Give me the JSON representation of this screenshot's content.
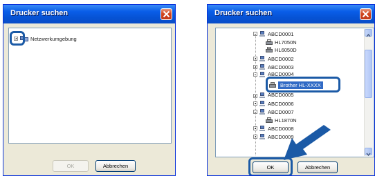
{
  "left_dialog": {
    "title": "Drucker suchen",
    "tree": [
      {
        "label": "Netzwerkumgebung",
        "icon": "network-icon"
      }
    ],
    "buttons": {
      "ok": "OK",
      "cancel": "Abbrechen"
    }
  },
  "right_dialog": {
    "title": "Drucker suchen",
    "tree": [
      {
        "label": "ABCD0001",
        "type": "computer",
        "expanded": true
      },
      {
        "label": "HL7050N",
        "type": "printer"
      },
      {
        "label": "HL6050D",
        "type": "printer"
      },
      {
        "label": "ABCD0002",
        "type": "computer",
        "expanded": false
      },
      {
        "label": "ABCD0003",
        "type": "computer",
        "expanded": false
      },
      {
        "label": "ABCD0004",
        "type": "computer",
        "expanded": true
      },
      {
        "label": "Brother HL-XXXX",
        "type": "printer",
        "selected": true
      },
      {
        "label": "ABCD0005",
        "type": "computer",
        "expanded": false
      },
      {
        "label": "ABCD0006",
        "type": "computer",
        "expanded": false
      },
      {
        "label": "ABCD0007",
        "type": "computer",
        "expanded": true
      },
      {
        "label": "HL1870N",
        "type": "printer"
      },
      {
        "label": "ABCD0008",
        "type": "computer",
        "expanded": false
      },
      {
        "label": "ABCD0009",
        "type": "computer",
        "expanded": false
      }
    ],
    "buttons": {
      "ok": "OK",
      "cancel": "Abbrechen"
    }
  },
  "colors": {
    "titlebar": "#0a5ee8",
    "highlight": "#1b5aa6",
    "selection": "#316ac5",
    "close": "#d2461f"
  }
}
